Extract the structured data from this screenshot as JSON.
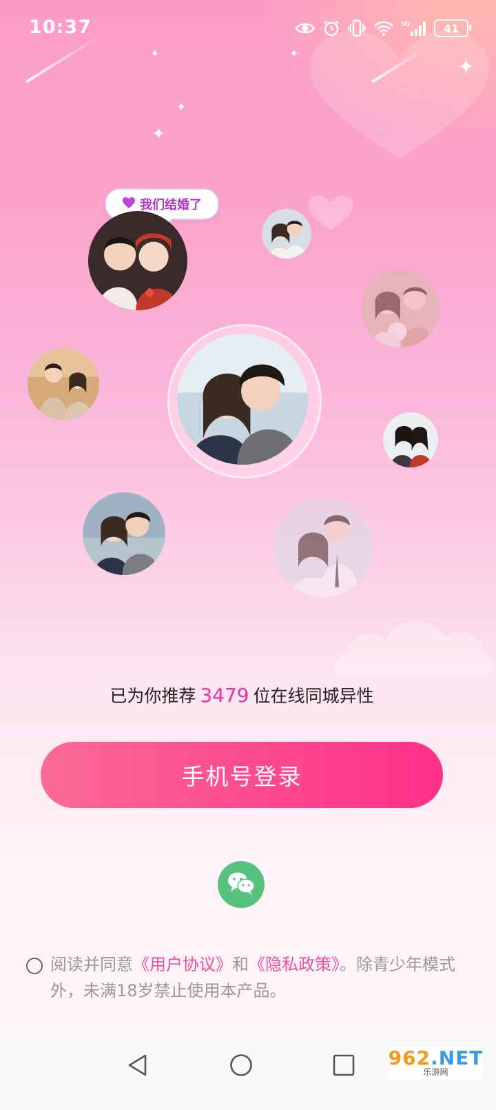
{
  "status_bar": {
    "time": "10:37",
    "battery": "41",
    "icons": [
      "eye-icon",
      "alarm-icon",
      "vibrate-icon",
      "wifi-icon",
      "signal-5g-icon",
      "battery-icon"
    ]
  },
  "badge": {
    "text": "我们结婚了",
    "icon": "heart-icon",
    "color": "#b034c9"
  },
  "recommend": {
    "prefix": "已为你推荐",
    "count": "3479",
    "suffix": "位在线同城异性",
    "accent": "#e8339c"
  },
  "login": {
    "label": "手机号登录",
    "gradient_start": "#fb6a95",
    "gradient_end": "#fe2f8a"
  },
  "wechat": {
    "icon": "wechat-icon",
    "color": "#57c27e"
  },
  "agreement": {
    "prefix": "阅读并同意",
    "user_agreement": "《用户协议》",
    "conjunction": "和",
    "privacy_policy": "《隐私政策》",
    "suffix": "。除青少年模式外，未满18岁禁止使用本产品。",
    "link_color": "#e94fa0"
  },
  "nav_bar": {
    "back": "back-icon",
    "home": "home-icon",
    "recents": "recents-icon"
  },
  "watermark": {
    "logo_num": "962",
    "logo_text": ".NET",
    "sub": "乐游网"
  }
}
